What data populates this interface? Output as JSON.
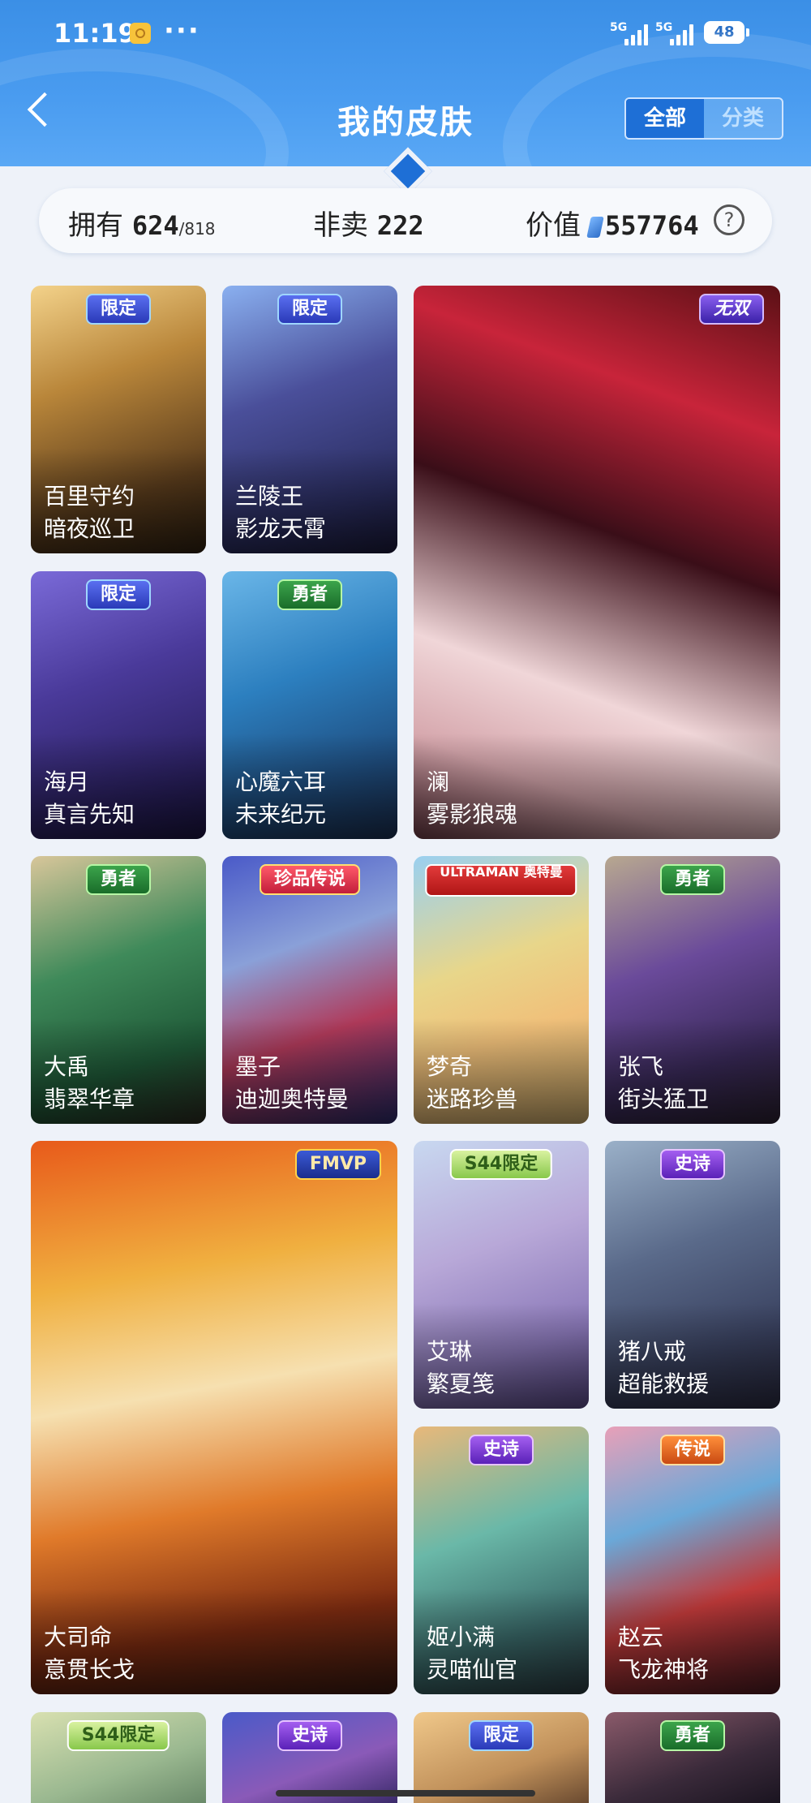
{
  "status_bar": {
    "time": "11:19",
    "more": "···",
    "signal1": "5G",
    "signal2": "5G",
    "battery": "48"
  },
  "header": {
    "title": "我的皮肤",
    "tab_all": "全部",
    "tab_category": "分类"
  },
  "stats": {
    "owned_label": "拥有",
    "owned_value": "624",
    "owned_total": "/818",
    "not_sale_label": "非卖",
    "not_sale_value": "222",
    "value_label": "价值",
    "value_value": "557764",
    "help": "?"
  },
  "cards": [
    {
      "hero": "百里守约",
      "skin": "暗夜巡卫",
      "badge": "限定"
    },
    {
      "hero": "兰陵王",
      "skin": "影龙天霄",
      "badge": "限定"
    },
    {
      "hero": "澜",
      "skin": "雾影狼魂",
      "badge": "无双"
    },
    {
      "hero": "海月",
      "skin": "真言先知",
      "badge": "限定"
    },
    {
      "hero": "心魔六耳",
      "skin": "未来纪元",
      "badge": "勇者"
    },
    {
      "hero": "大禹",
      "skin": "翡翠华章",
      "badge": "勇者"
    },
    {
      "hero": "墨子",
      "skin": "迪迦奥特曼",
      "badge": "珍品传说"
    },
    {
      "hero": "梦奇",
      "skin": "迷路珍兽",
      "badge": "ULTRAMAN 奥特曼"
    },
    {
      "hero": "张飞",
      "skin": "街头猛卫",
      "badge": "勇者"
    },
    {
      "hero": "大司命",
      "skin": "意贯长戈",
      "badge": "FMVP"
    },
    {
      "hero": "艾琳",
      "skin": "繁夏笺",
      "badge": "S44限定"
    },
    {
      "hero": "猪八戒",
      "skin": "超能救援",
      "badge": "史诗"
    },
    {
      "hero": "姬小满",
      "skin": "灵喵仙官",
      "badge": "史诗"
    },
    {
      "hero": "赵云",
      "skin": "飞龙神将",
      "badge": "传说"
    }
  ],
  "partial_badges": [
    "S44限定",
    "史诗",
    "限定",
    "勇者"
  ],
  "colors": {
    "header_blue": "#3b8fe6",
    "segment_active": "#1e6fd6",
    "page_bg": "#eef2f9"
  }
}
